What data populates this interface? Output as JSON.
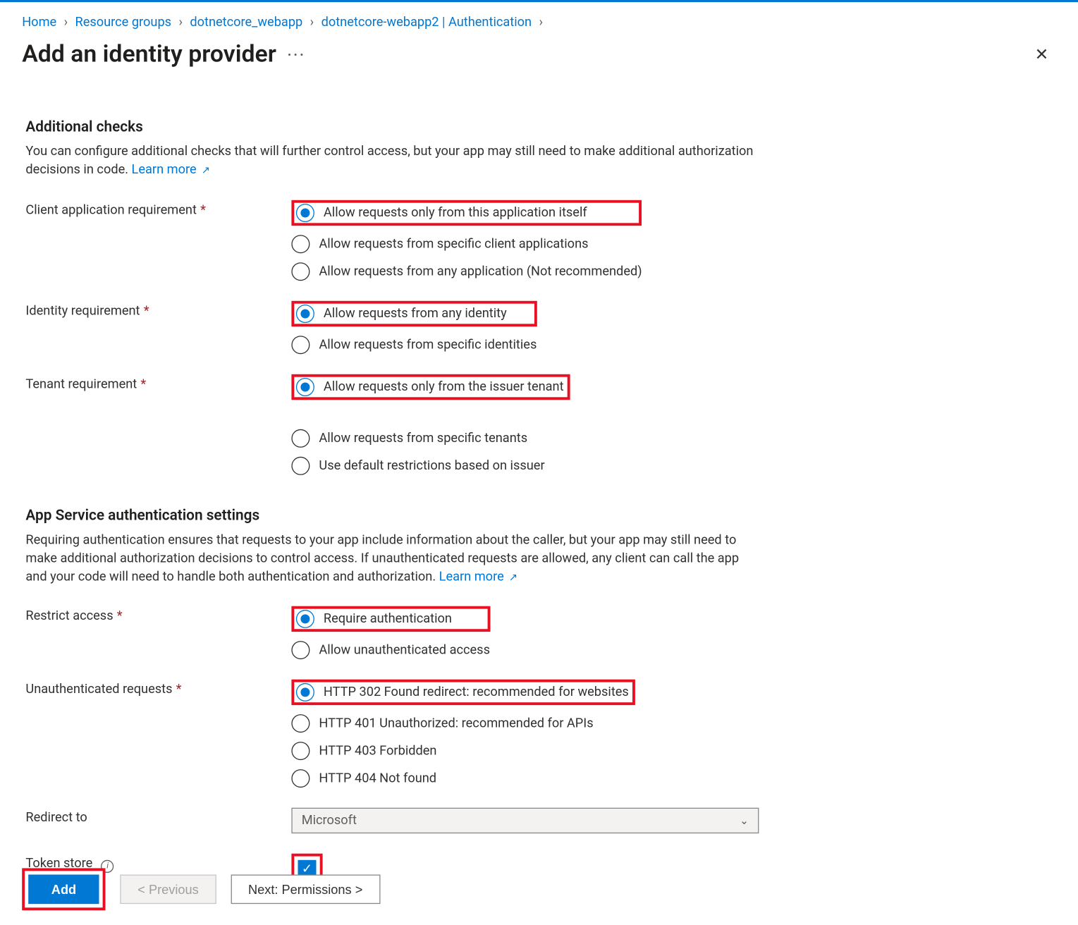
{
  "breadcrumb": {
    "items": [
      "Home",
      "Resource groups",
      "dotnetcore_webapp",
      "dotnetcore-webapp2 | Authentication"
    ]
  },
  "title": "Add an identity provider",
  "section1": {
    "heading": "Additional checks",
    "desc": "You can configure additional checks that will further control access, but your app may still need to make additional authorization decisions in code. ",
    "learn": "Learn more"
  },
  "fields": {
    "client_app": {
      "label": "Client application requirement",
      "options": [
        "Allow requests only from this application itself",
        "Allow requests from specific client applications",
        "Allow requests from any application (Not recommended)"
      ]
    },
    "identity": {
      "label": "Identity requirement",
      "options": [
        "Allow requests from any identity",
        "Allow requests from specific identities"
      ]
    },
    "tenant": {
      "label": "Tenant requirement",
      "options": [
        "Allow requests only from the issuer tenant",
        "Allow requests from specific tenants",
        "Use default restrictions based on issuer"
      ]
    }
  },
  "section2": {
    "heading": "App Service authentication settings",
    "desc": "Requiring authentication ensures that requests to your app include information about the caller, but your app may still need to make additional authorization decisions to control access. If unauthenticated requests are allowed, any client can call the app and your code will need to handle both authentication and authorization. ",
    "learn": "Learn more"
  },
  "fields2": {
    "restrict": {
      "label": "Restrict access",
      "options": [
        "Require authentication",
        "Allow unauthenticated access"
      ]
    },
    "unauth": {
      "label": "Unauthenticated requests",
      "options": [
        "HTTP 302 Found redirect: recommended for websites",
        "HTTP 401 Unauthorized: recommended for APIs",
        "HTTP 403 Forbidden",
        "HTTP 404 Not found"
      ]
    },
    "redirect": {
      "label": "Redirect to",
      "value": "Microsoft"
    },
    "token": {
      "label": "Token store"
    }
  },
  "footer": {
    "add": "Add",
    "prev": "<  Previous",
    "next": "Next: Permissions  >"
  }
}
